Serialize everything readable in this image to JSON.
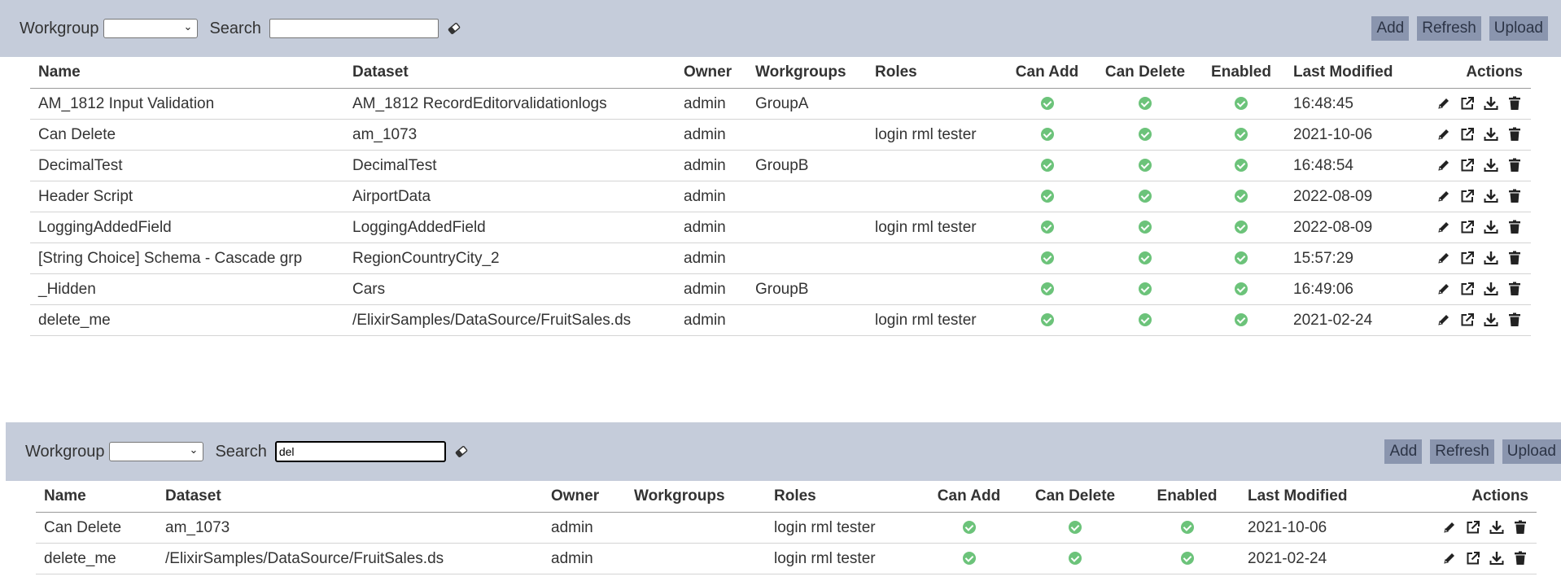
{
  "panels": [
    {
      "workgroup_label": "Workgroup",
      "workgroup_value": "",
      "search_label": "Search",
      "search_value": "",
      "buttons": {
        "add": "Add",
        "refresh": "Refresh",
        "upload": "Upload"
      },
      "columns": [
        "Name",
        "Dataset",
        "Owner",
        "Workgroups",
        "Roles",
        "Can Add",
        "Can Delete",
        "Enabled",
        "Last Modified",
        "Actions"
      ],
      "rows": [
        {
          "name": "AM_1812 Input Validation",
          "dataset": "AM_1812 RecordEditorvalidationlogs",
          "owner": "admin",
          "workgroups": "GroupA",
          "roles": "",
          "can_add": true,
          "can_delete": true,
          "enabled": true,
          "modified": "16:48:45"
        },
        {
          "name": "Can Delete",
          "dataset": "am_1073",
          "owner": "admin",
          "workgroups": "",
          "roles": "login rml tester",
          "can_add": true,
          "can_delete": true,
          "enabled": true,
          "modified": "2021-10-06"
        },
        {
          "name": "DecimalTest",
          "dataset": "DecimalTest",
          "owner": "admin",
          "workgroups": "GroupB",
          "roles": "",
          "can_add": true,
          "can_delete": true,
          "enabled": true,
          "modified": "16:48:54"
        },
        {
          "name": "Header Script",
          "dataset": "AirportData",
          "owner": "admin",
          "workgroups": "",
          "roles": "",
          "can_add": true,
          "can_delete": true,
          "enabled": true,
          "modified": "2022-08-09"
        },
        {
          "name": "LoggingAddedField",
          "dataset": "LoggingAddedField",
          "owner": "admin",
          "workgroups": "",
          "roles": "login rml tester",
          "can_add": true,
          "can_delete": true,
          "enabled": true,
          "modified": "2022-08-09"
        },
        {
          "name": "[String Choice] Schema - Cascade grp",
          "dataset": "RegionCountryCity_2",
          "owner": "admin",
          "workgroups": "",
          "roles": "",
          "can_add": true,
          "can_delete": true,
          "enabled": true,
          "modified": "15:57:29"
        },
        {
          "name": "_Hidden",
          "dataset": "Cars",
          "owner": "admin",
          "workgroups": "GroupB",
          "roles": "",
          "can_add": true,
          "can_delete": true,
          "enabled": true,
          "modified": "16:49:06"
        },
        {
          "name": "delete_me",
          "dataset": "/ElixirSamples/DataSource/FruitSales.ds",
          "owner": "admin",
          "workgroups": "",
          "roles": "login rml tester",
          "can_add": true,
          "can_delete": true,
          "enabled": true,
          "modified": "2021-02-24"
        }
      ]
    },
    {
      "workgroup_label": "Workgroup",
      "workgroup_value": "",
      "search_label": "Search",
      "search_value": "del",
      "buttons": {
        "add": "Add",
        "refresh": "Refresh",
        "upload": "Upload"
      },
      "columns": [
        "Name",
        "Dataset",
        "Owner",
        "Workgroups",
        "Roles",
        "Can Add",
        "Can Delete",
        "Enabled",
        "Last Modified",
        "Actions"
      ],
      "rows": [
        {
          "name": "Can Delete",
          "dataset": "am_1073",
          "owner": "admin",
          "workgroups": "",
          "roles": "login rml tester",
          "can_add": true,
          "can_delete": true,
          "enabled": true,
          "modified": "2021-10-06"
        },
        {
          "name": "delete_me",
          "dataset": "/ElixirSamples/DataSource/FruitSales.ds",
          "owner": "admin",
          "workgroups": "",
          "roles": "login rml tester",
          "can_add": true,
          "can_delete": true,
          "enabled": true,
          "modified": "2021-02-24"
        }
      ]
    }
  ],
  "icons": {
    "eraser": "eraser-icon",
    "check": "check-circle-icon",
    "edit": "pencil-icon",
    "open": "external-link-icon",
    "download": "download-icon",
    "delete": "trash-icon"
  },
  "colors": {
    "toolbar_bg": "#c5ccda",
    "button_bg": "#8a95ae",
    "check_green": "#6cc37a"
  }
}
